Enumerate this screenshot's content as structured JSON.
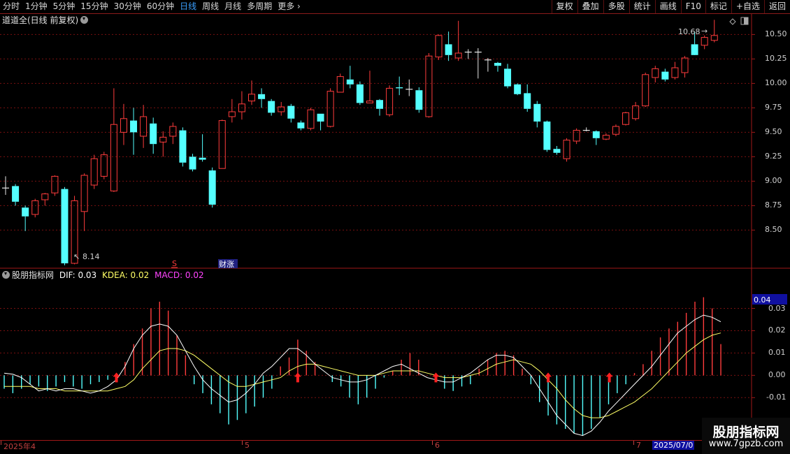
{
  "toolbar": {
    "periods": [
      "分时",
      "1分钟",
      "5分钟",
      "15分钟",
      "30分钟",
      "60分钟",
      "日线",
      "周线",
      "月线",
      "多周期",
      "更多"
    ],
    "active_period": "日线",
    "right_buttons": [
      "复权",
      "叠加",
      "多股",
      "统计",
      "画线",
      "F10",
      "标记",
      "+自选",
      "返回"
    ]
  },
  "main_panel": {
    "title": "道道全(日线 前复权)"
  },
  "indicator_panel": {
    "name": "股朋指标网",
    "dif_label": "DIF: 0.03",
    "kdea_label": "KDEA: 0.02",
    "macd_label": "MACD: 0.02",
    "dif_color": "#ffffff",
    "kdea_color": "#ffff66",
    "macd_color": "#ff44ff",
    "current_value_badge": "0.04"
  },
  "date_axis": {
    "labels": [
      "2025年4",
      "5",
      "6",
      "7"
    ],
    "highlight": "2025/07/0"
  },
  "annotations": {
    "low_label": "8.14",
    "high_label": "10.68",
    "marker_s": "S",
    "marker_cai": "财涨"
  },
  "watermark": {
    "line1": "股朋指标网",
    "line2": "www.7gpzb.com"
  },
  "colors": {
    "up": "#ff3c3c",
    "down": "#54ffff",
    "grid": "#7a1010",
    "border": "#a01818",
    "highlight_bg": "#1010a0"
  },
  "chart_data": [
    {
      "type": "candlestick",
      "y_ticks": [
        "10.50",
        "10.25",
        "10.00",
        "9.75",
        "9.50",
        "9.25",
        "9.00",
        "8.75",
        "8.50"
      ],
      "ylim": [
        8.11,
        10.71
      ],
      "candles": [
        [
          8.93,
          8.93,
          9.05,
          8.86
        ],
        [
          8.95,
          8.79,
          8.97,
          8.75
        ],
        [
          8.73,
          8.64,
          8.75,
          8.49
        ],
        [
          8.66,
          8.8,
          8.82,
          8.63
        ],
        [
          8.81,
          8.87,
          8.88,
          8.75
        ],
        [
          8.88,
          9.05,
          9.06,
          8.85
        ],
        [
          8.92,
          8.16,
          8.94,
          8.14
        ],
        [
          8.16,
          8.8,
          8.85,
          8.15
        ],
        [
          8.69,
          9.06,
          9.08,
          8.49
        ],
        [
          8.96,
          9.23,
          9.27,
          8.92
        ],
        [
          9.05,
          9.27,
          9.3,
          9.02
        ],
        [
          8.9,
          9.58,
          9.95,
          8.89
        ],
        [
          9.5,
          9.64,
          9.79,
          9.37
        ],
        [
          9.62,
          9.5,
          9.75,
          9.27
        ],
        [
          9.46,
          9.66,
          9.78,
          9.34
        ],
        [
          9.59,
          9.38,
          9.65,
          9.28
        ],
        [
          9.4,
          9.45,
          9.51,
          9.25
        ],
        [
          9.46,
          9.56,
          9.6,
          9.38
        ],
        [
          9.52,
          9.19,
          9.55,
          9.15
        ],
        [
          9.25,
          9.12,
          9.28,
          9.1
        ],
        [
          9.24,
          9.22,
          9.48,
          9.2
        ],
        [
          9.11,
          8.76,
          9.14,
          8.73
        ],
        [
          9.13,
          9.62,
          9.63,
          9.13
        ],
        [
          9.66,
          9.71,
          9.84,
          9.6
        ],
        [
          9.71,
          9.79,
          9.92,
          9.63
        ],
        [
          9.82,
          9.89,
          10.03,
          9.78
        ],
        [
          9.89,
          9.84,
          9.95,
          9.75
        ],
        [
          9.82,
          9.7,
          9.84,
          9.67
        ],
        [
          9.71,
          9.76,
          9.81,
          9.67
        ],
        [
          9.77,
          9.64,
          9.79,
          9.6
        ],
        [
          9.6,
          9.54,
          9.62,
          9.52
        ],
        [
          9.54,
          9.73,
          9.75,
          9.52
        ],
        [
          9.69,
          9.61,
          9.69,
          9.52
        ],
        [
          9.56,
          9.92,
          9.95,
          9.55
        ],
        [
          9.91,
          10.07,
          10.1,
          9.91
        ],
        [
          10.04,
          9.99,
          10.18,
          9.95
        ],
        [
          9.99,
          9.8,
          10.02,
          9.78
        ],
        [
          9.8,
          9.82,
          10.13,
          9.8
        ],
        [
          9.83,
          9.74,
          9.84,
          9.67
        ],
        [
          9.68,
          9.95,
          9.98,
          9.66
        ],
        [
          9.96,
          9.95,
          10.07,
          9.88
        ],
        [
          9.94,
          9.94,
          10.04,
          9.87
        ],
        [
          9.93,
          9.73,
          9.96,
          9.7
        ],
        [
          9.66,
          10.28,
          10.31,
          9.65
        ],
        [
          10.27,
          10.49,
          10.5,
          10.24
        ],
        [
          10.4,
          10.29,
          10.53,
          10.23
        ],
        [
          10.26,
          10.31,
          10.64,
          10.23
        ],
        [
          10.32,
          10.32,
          10.35,
          10.25
        ],
        [
          10.32,
          10.32,
          10.36,
          10.05
        ],
        [
          10.24,
          10.24,
          10.26,
          10.12
        ],
        [
          10.21,
          10.18,
          10.22,
          10.12
        ],
        [
          10.15,
          9.97,
          10.2,
          9.95
        ],
        [
          9.99,
          9.89,
          10.0,
          9.88
        ],
        [
          9.9,
          9.74,
          9.99,
          9.71
        ],
        [
          9.79,
          9.61,
          9.82,
          9.55
        ],
        [
          9.61,
          9.32,
          9.62,
          9.3
        ],
        [
          9.33,
          9.29,
          9.36,
          9.27
        ],
        [
          9.23,
          9.42,
          9.44,
          9.2
        ],
        [
          9.41,
          9.52,
          9.54,
          9.38
        ],
        [
          9.52,
          9.52,
          9.55,
          9.51
        ],
        [
          9.51,
          9.44,
          9.52,
          9.37
        ],
        [
          9.43,
          9.47,
          9.49,
          9.42
        ],
        [
          9.48,
          9.56,
          9.58,
          9.46
        ],
        [
          9.58,
          9.7,
          9.71,
          9.57
        ],
        [
          9.64,
          9.77,
          9.81,
          9.62
        ],
        [
          9.77,
          10.09,
          10.11,
          9.76
        ],
        [
          10.06,
          10.15,
          10.18,
          10.01
        ],
        [
          10.12,
          10.04,
          10.15,
          10.02
        ],
        [
          10.06,
          10.16,
          10.22,
          10.04
        ],
        [
          10.11,
          10.26,
          10.28,
          10.06
        ],
        [
          10.4,
          10.29,
          10.53,
          10.37
        ],
        [
          10.39,
          10.47,
          10.49,
          10.35
        ],
        [
          10.44,
          10.49,
          10.65,
          10.42
        ]
      ]
    },
    {
      "type": "line+bar",
      "y_ticks": [
        "0.03",
        "0.02",
        "0.01",
        "0.00",
        "-0.01"
      ],
      "ylim": [
        -0.029,
        0.043
      ],
      "dif": [
        0.001,
        0.0005,
        -0.001,
        -0.004,
        -0.007,
        -0.006,
        -0.007,
        -0.006,
        -0.006,
        -0.007,
        -0.008,
        -0.007,
        -0.005,
        -0.002,
        0.004,
        0.012,
        0.018,
        0.022,
        0.023,
        0.022,
        0.018,
        0.011,
        0.004,
        -0.002,
        -0.006,
        -0.009,
        -0.012,
        -0.011,
        -0.008,
        -0.004,
        0.001,
        0.004,
        0.008,
        0.012,
        0.012,
        0.009,
        0.005,
        0.002,
        -0.001,
        -0.002,
        -0.003,
        -0.003,
        -0.002,
        0.0,
        0.002,
        0.004,
        0.005,
        0.003,
        0.001,
        -0.001,
        -0.002,
        -0.003,
        -0.003,
        -0.001,
        0.001,
        0.004,
        0.007,
        0.009,
        0.009,
        0.008,
        0.004,
        0.0,
        -0.006,
        -0.012,
        -0.018,
        -0.022,
        -0.026,
        -0.027,
        -0.025,
        -0.021,
        -0.016,
        -0.012,
        -0.008,
        -0.004,
        0.0,
        0.004,
        0.009,
        0.014,
        0.019,
        0.022,
        0.025,
        0.027,
        0.026,
        0.024
      ],
      "kdea": [
        -0.005,
        -0.005,
        -0.005,
        -0.005,
        -0.006,
        -0.006,
        -0.006,
        -0.007,
        -0.007,
        -0.007,
        -0.007,
        -0.007,
        -0.007,
        -0.006,
        -0.005,
        -0.002,
        0.003,
        0.007,
        0.011,
        0.012,
        0.012,
        0.011,
        0.009,
        0.006,
        0.003,
        0.0,
        -0.003,
        -0.005,
        -0.005,
        -0.004,
        -0.003,
        -0.002,
        -0.001,
        0.002,
        0.004,
        0.005,
        0.005,
        0.004,
        0.003,
        0.002,
        0.001,
        0.0,
        0.0,
        0.0,
        0.001,
        0.002,
        0.002,
        0.002,
        0.002,
        0.001,
        0.0,
        -0.001,
        -0.001,
        -0.001,
        0.0,
        0.001,
        0.003,
        0.005,
        0.006,
        0.007,
        0.006,
        0.005,
        0.002,
        -0.002,
        -0.006,
        -0.011,
        -0.015,
        -0.018,
        -0.019,
        -0.019,
        -0.018,
        -0.016,
        -0.014,
        -0.012,
        -0.009,
        -0.006,
        -0.002,
        0.002,
        0.006,
        0.01,
        0.013,
        0.016,
        0.018,
        0.019
      ],
      "macd": [
        -0.006,
        -0.008,
        -0.006,
        -0.004,
        -0.005,
        -0.007,
        -0.005,
        -0.003,
        -0.005,
        -0.006,
        -0.004,
        -0.003,
        -0.002,
        0.001,
        0.006,
        0.014,
        0.021,
        0.03,
        0.033,
        0.029,
        0.018,
        0.009,
        -0.004,
        -0.008,
        -0.013,
        -0.017,
        -0.022,
        -0.02,
        -0.017,
        -0.014,
        -0.01,
        -0.006,
        0.004,
        0.008,
        0.016,
        0.011,
        0.006,
        0.0,
        -0.003,
        -0.005,
        -0.01,
        -0.013,
        -0.01,
        -0.006,
        -0.001,
        0.002,
        0.007,
        0.01,
        0.007,
        0.0,
        -0.003,
        -0.006,
        -0.007,
        -0.005,
        -0.004,
        0.003,
        0.007,
        0.01,
        0.011,
        0.009,
        0.003,
        -0.004,
        -0.012,
        -0.018,
        -0.022,
        -0.024,
        -0.026,
        -0.027,
        -0.024,
        -0.019,
        -0.013,
        -0.008,
        -0.004,
        0.001,
        0.005,
        0.011,
        0.017,
        0.021,
        0.024,
        0.028,
        0.033,
        0.035,
        0.03,
        0.014
      ],
      "buy_arrow_indices": [
        13,
        34,
        50,
        63,
        86
      ]
    }
  ]
}
